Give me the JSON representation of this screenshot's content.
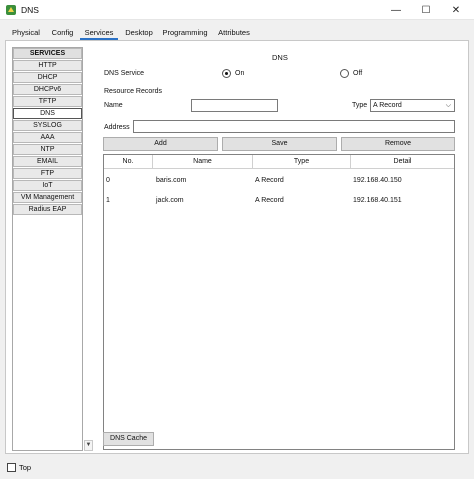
{
  "window": {
    "title": "DNS",
    "icon": "packet-tracer-icon",
    "controls": {
      "minimize": "—",
      "maximize": "☐",
      "close": "✕"
    }
  },
  "tabs": [
    {
      "label": "Physical",
      "active": false
    },
    {
      "label": "Config",
      "active": false
    },
    {
      "label": "Services",
      "active": true
    },
    {
      "label": "Desktop",
      "active": false
    },
    {
      "label": "Programming",
      "active": false
    },
    {
      "label": "Attributes",
      "active": false
    }
  ],
  "services": {
    "header": "SERVICES",
    "items": [
      "HTTP",
      "DHCP",
      "DHCPv6",
      "TFTP",
      "DNS",
      "SYSLOG",
      "AAA",
      "NTP",
      "EMAIL",
      "FTP",
      "IoT",
      "VM Management",
      "Radius EAP"
    ],
    "selected": "DNS"
  },
  "dns": {
    "panel_title": "DNS",
    "service_label": "DNS Service",
    "on_label": "On",
    "off_label": "Off",
    "service_state": "On",
    "resource_records_label": "Resource Records",
    "name_label": "Name",
    "name_value": "",
    "type_label": "Type",
    "type_value": "A Record",
    "address_label": "Address",
    "address_value": "",
    "add_button": "Add",
    "save_button": "Save",
    "remove_button": "Remove",
    "cache_button": "DNS Cache"
  },
  "table": {
    "columns": [
      "No.",
      "Name",
      "Type",
      "Detail"
    ],
    "rows": [
      {
        "no": "0",
        "name": "baris.com",
        "type": "A Record",
        "detail": "192.168.40.150"
      },
      {
        "no": "1",
        "name": "jack.com",
        "type": "A Record",
        "detail": "192.168.40.151"
      }
    ]
  },
  "footer": {
    "top_label": "Top",
    "top_checked": false
  }
}
